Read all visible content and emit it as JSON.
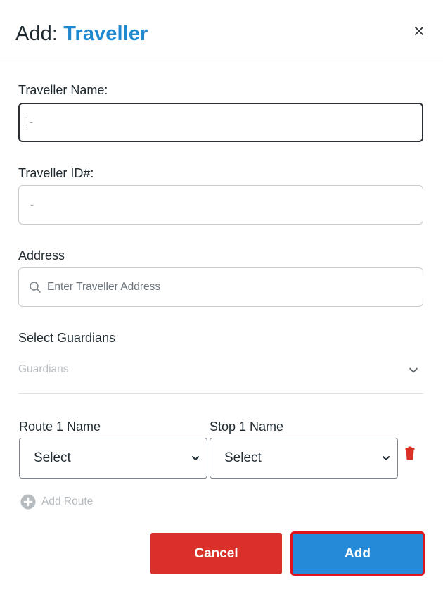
{
  "header": {
    "title_prefix": "Add: ",
    "title_accent": "Traveller",
    "close_icon": "close-icon"
  },
  "form": {
    "traveller_name": {
      "label": "Traveller Name:",
      "placeholder": "-",
      "value": ""
    },
    "traveller_id": {
      "label": "Traveller ID#:",
      "placeholder": "-",
      "value": ""
    },
    "address": {
      "label": "Address",
      "placeholder": "Enter Traveller Address",
      "icon": "search-icon"
    },
    "guardians": {
      "label": "Select Guardians",
      "placeholder": "Guardians",
      "icon": "chevron-down-icon"
    },
    "routes": [
      {
        "route_label": "Route 1 Name",
        "stop_label": "Stop 1 Name",
        "route_value": "Select",
        "stop_value": "Select",
        "delete_icon": "trash-icon"
      }
    ],
    "add_route_label": "Add Route"
  },
  "actions": {
    "cancel_label": "Cancel",
    "add_label": "Add"
  },
  "colors": {
    "accent": "#1f8ad1",
    "cancel": "#d9312a",
    "primary": "#258ad8",
    "danger": "#d9312a",
    "focus_outline": "#e0141c"
  }
}
